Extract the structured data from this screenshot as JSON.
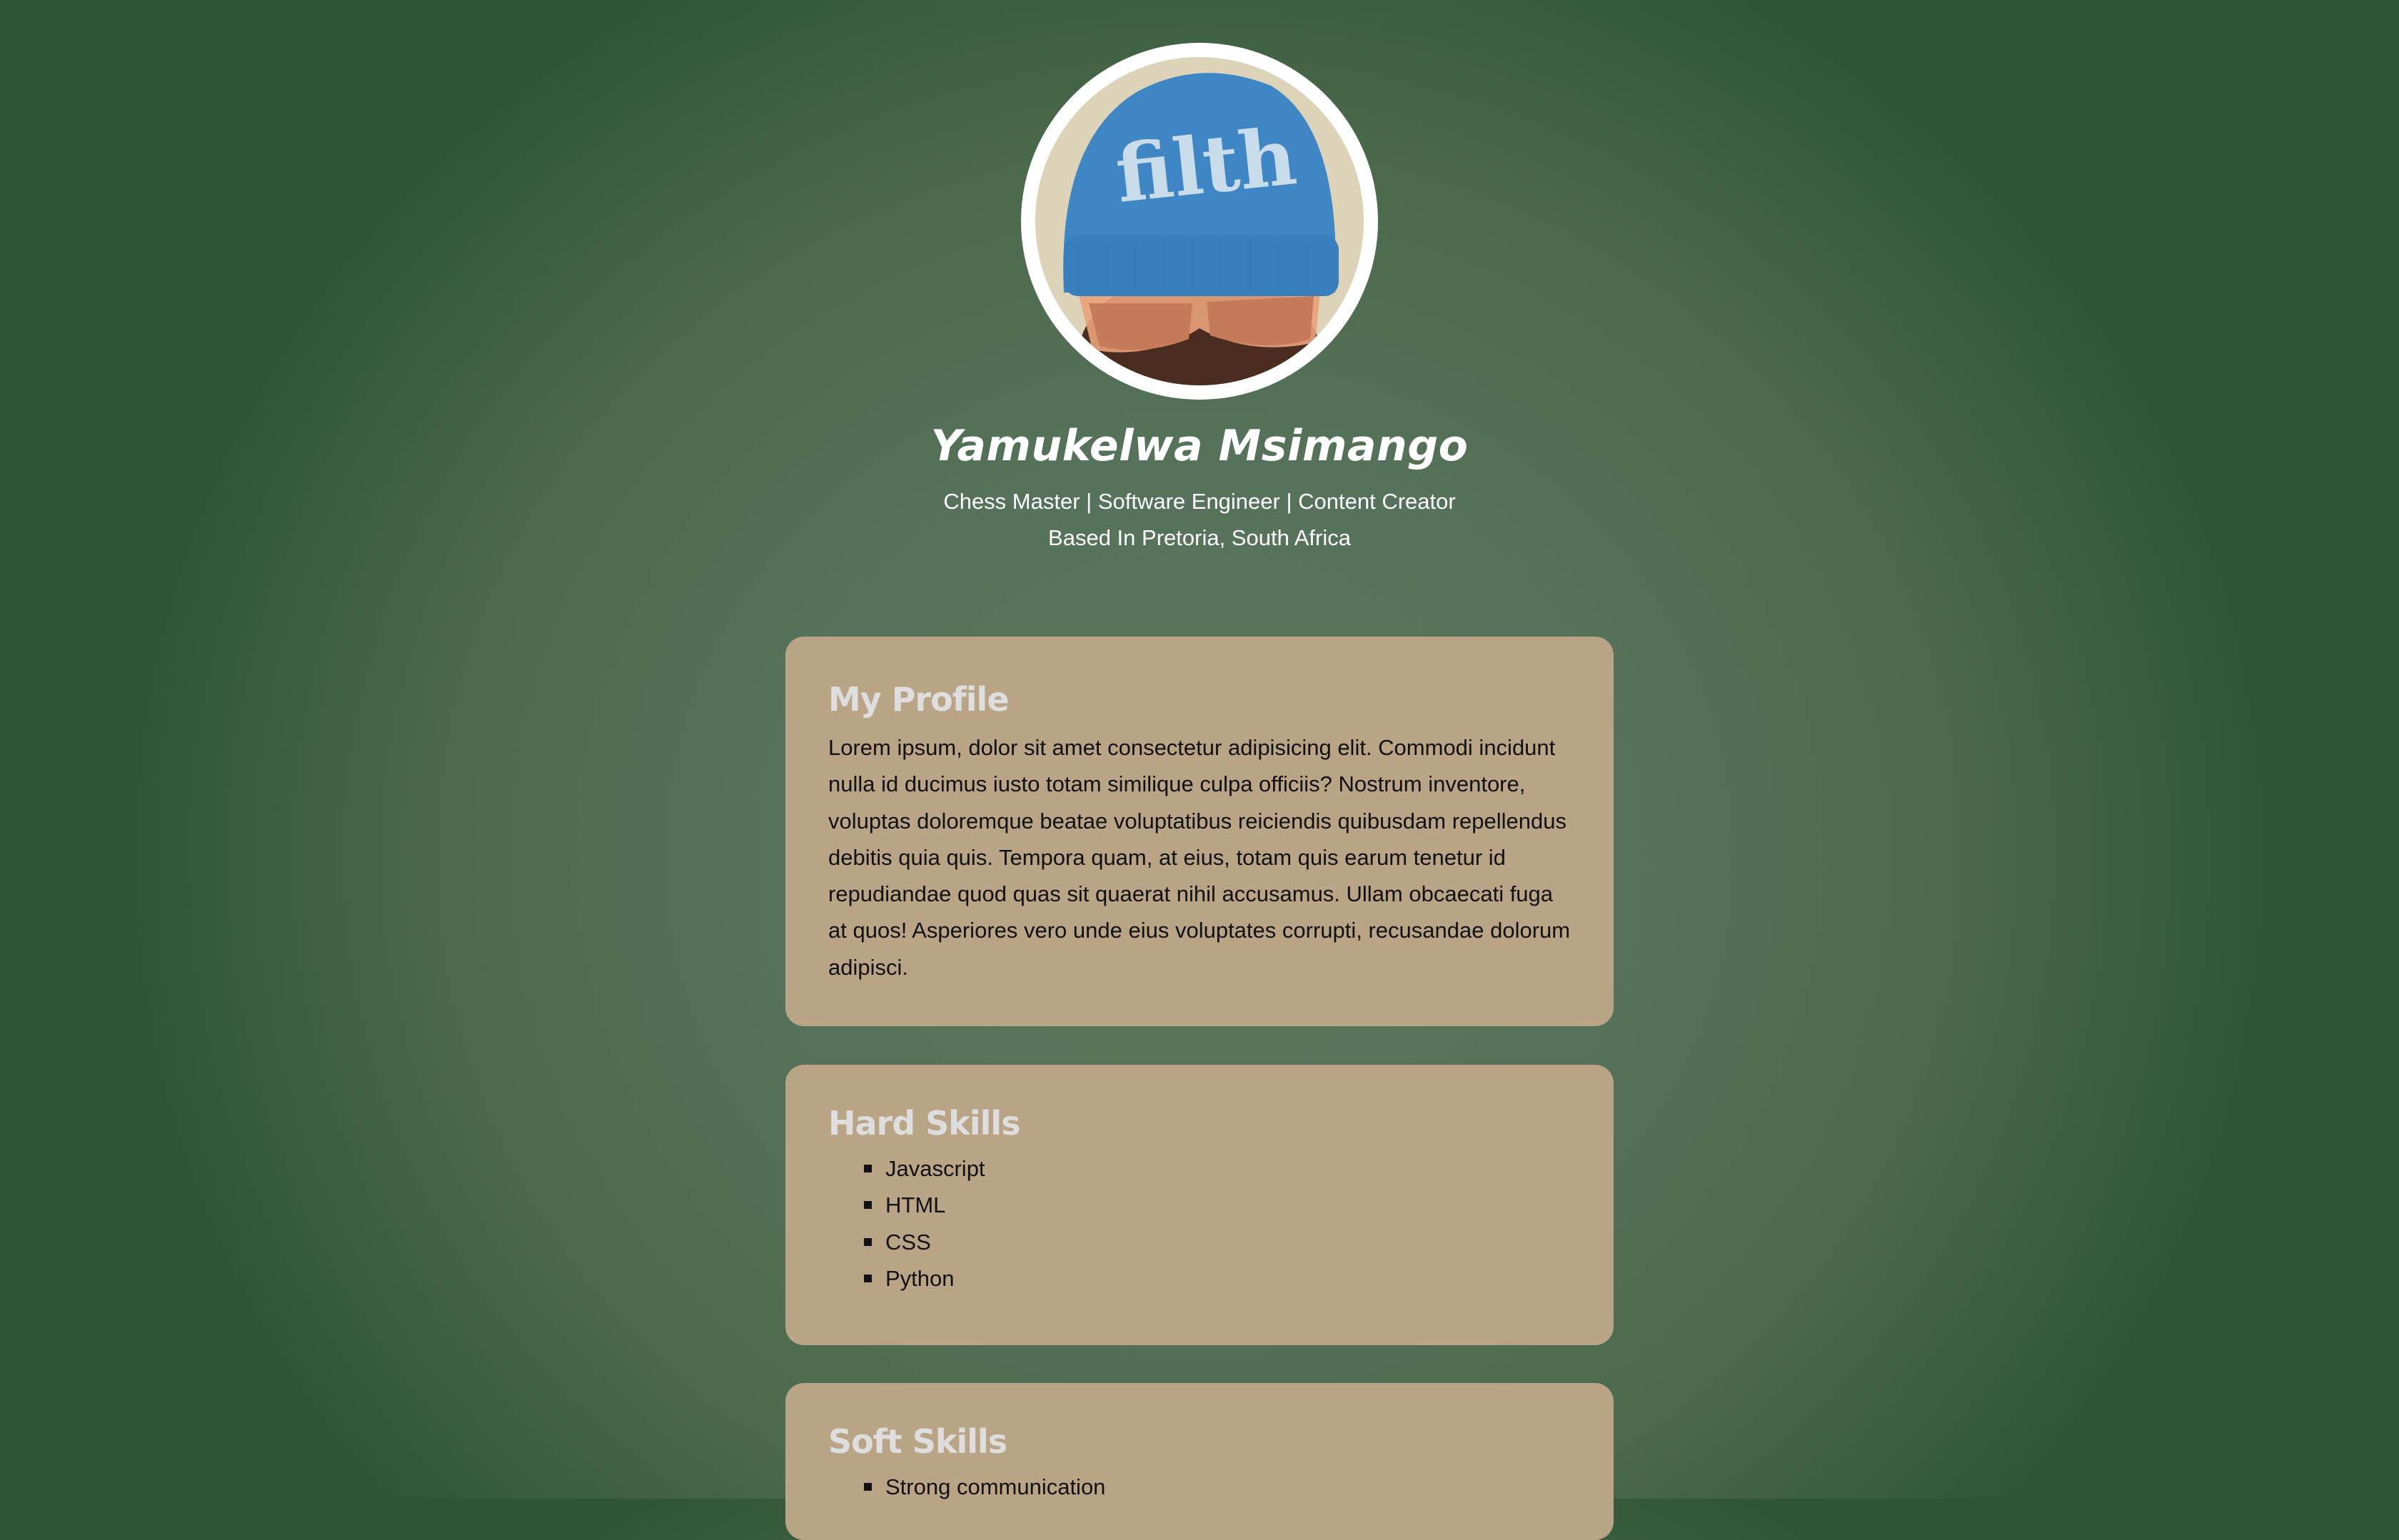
{
  "header": {
    "name": "Yamukelwa Msimango",
    "tagline": "Chess Master | Software Engineer | Content Creator",
    "location": "Based In Pretoria, South Africa",
    "avatar_beanie_text": "filth"
  },
  "profile": {
    "title": "My Profile",
    "body": "Lorem ipsum, dolor sit amet consectetur adipisicing elit. Commodi incidunt nulla id ducimus iusto totam similique culpa officiis? Nostrum inventore, voluptas doloremque beatae voluptatibus reiciendis quibusdam repellendus debitis quia quis. Tempora quam, at eius, totam quis earum tenetur id repudiandae quod quas sit quaerat nihil accusamus. Ullam obcaecati fuga at quos! Asperiores vero unde eius voluptates corrupti, recusandae dolorum adipisci."
  },
  "hard_skills": {
    "title": "Hard Skills",
    "items": [
      "Javascript",
      "HTML",
      "CSS",
      "Python"
    ]
  },
  "soft_skills": {
    "title": "Soft Skills",
    "items": [
      "Strong communication"
    ]
  },
  "colors": {
    "background": "#52705a",
    "card": "#b9a585",
    "heading": "#dedede",
    "text": "#111111"
  }
}
